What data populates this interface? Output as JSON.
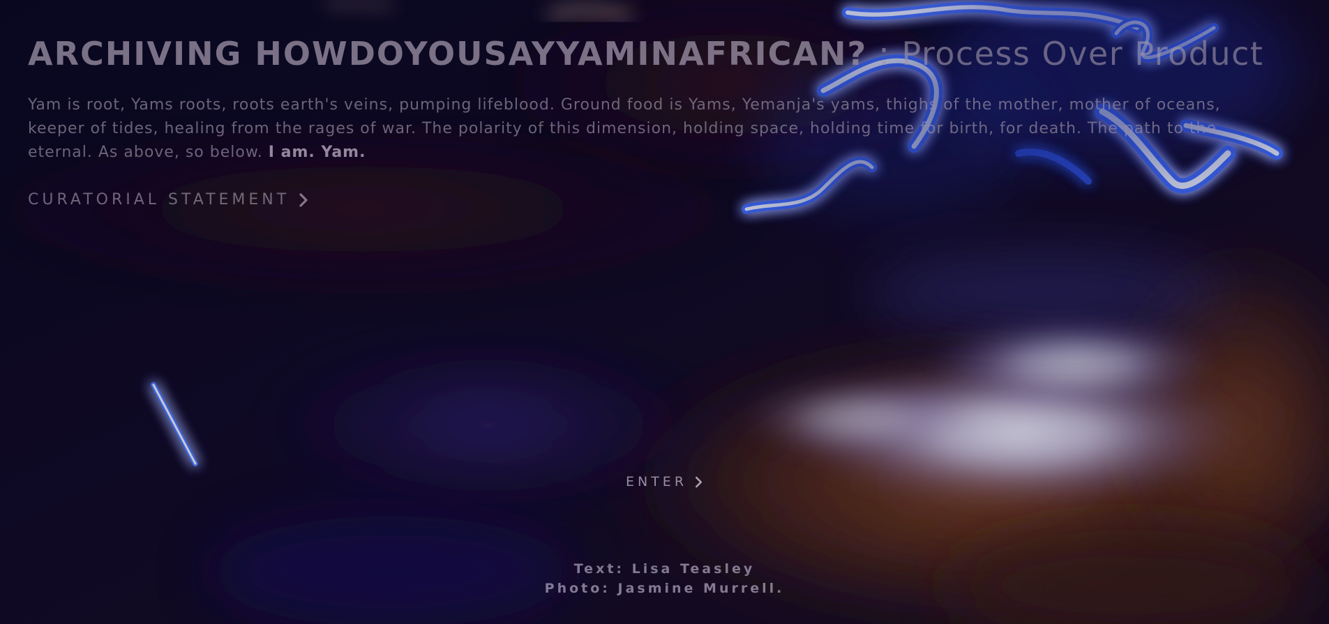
{
  "colors": {
    "background_dark": "#08081f",
    "glow_blue": "#2f6bff",
    "glow_white": "#e8ecff",
    "warm_brown": "#6a3418",
    "text_muted": "#968ca0"
  },
  "header": {
    "title_strong": "ARCHIVING HOWDOYOUSAYYAMINAFRICAN?",
    "title_light": " : Process Over Product"
  },
  "intro": {
    "text": "Yam is root, Yams roots, roots earth's veins, pumping lifeblood. Ground food is Yams, Yemanja's yams, thighs of the mother, mother of oceans, keeper of tides, healing from the rages of war. The polarity of this dimension, holding space, holding time for birth, for death. The path to the eternal. As above, so below. ",
    "emphasis": "I am. Yam."
  },
  "links": {
    "curatorial_label": "CURATORIAL STATEMENT",
    "curatorial_icon": "chevron-right-icon",
    "enter_label": "ENTER",
    "enter_icon": "chevron-right-icon"
  },
  "credits": {
    "text_line": "Text: Lisa Teasley",
    "photo_line": "Photo: Jasmine Murrell."
  }
}
